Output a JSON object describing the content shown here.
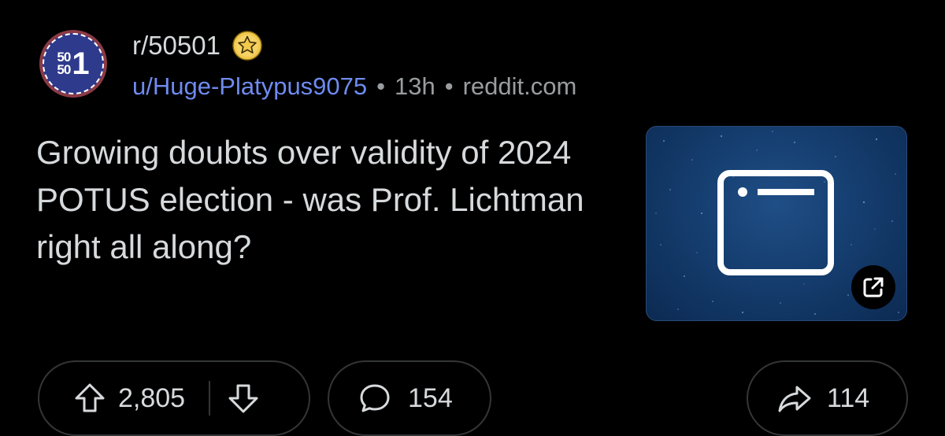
{
  "post": {
    "subreddit": {
      "name": "r/50501",
      "avatar_text_small_top": "50",
      "avatar_text_small_bottom": "50",
      "avatar_text_large": "1",
      "badge_icon": "star-badge-icon"
    },
    "meta": {
      "author": "u/Huge-Platypus9075",
      "separator": "•",
      "age": "13h",
      "domain": "reddit.com"
    },
    "title": "Growing doubts over validity of 2024 POTUS election - was Prof. Lichtman right all along?",
    "thumbnail": {
      "icon": "browser-window-icon",
      "overlay_icon": "open-external-icon"
    }
  },
  "actions": {
    "upvote_icon": "upvote-arrow-icon",
    "vote_count": "2,805",
    "downvote_icon": "downvote-arrow-icon",
    "comment_icon": "comment-bubble-icon",
    "comment_count": "154",
    "share_icon": "share-arrow-icon",
    "share_count": "114"
  },
  "colors": {
    "background": "#000000",
    "text": "#d7dadc",
    "author_link": "#6f8bf0",
    "muted": "#9a9da0",
    "border": "#343536",
    "thumbnail_bg": "#133a6a"
  }
}
